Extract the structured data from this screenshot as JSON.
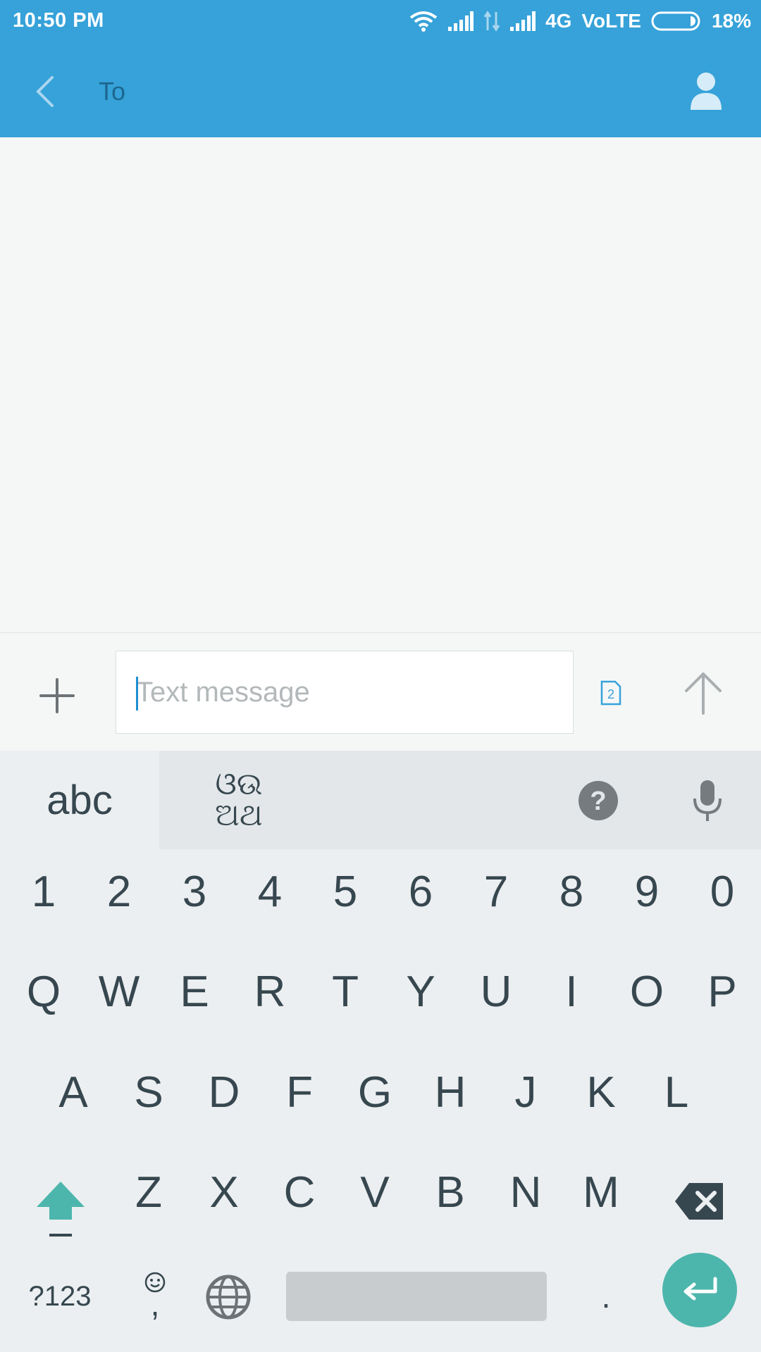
{
  "status_bar": {
    "time": "10:50 PM",
    "network": "4G",
    "volte": "VoLTE",
    "battery": "18%",
    "icons": [
      "wifi-icon",
      "signal-icon",
      "data-transfer-icon",
      "signal-icon",
      "battery-icon"
    ]
  },
  "header": {
    "to_label": "To",
    "back_icon": "chevron-left-icon",
    "contact_icon": "person-icon"
  },
  "composer": {
    "attach_icon": "plus-icon",
    "placeholder": "Text message",
    "value": "",
    "sim_label": "2",
    "send_icon": "arrow-up-icon"
  },
  "keyboard": {
    "tab_abc": "abc",
    "tab_odia_line1": "ଓଉ",
    "tab_odia_line2": "ଅଥ",
    "help_icon": "help-circle-icon",
    "mic_icon": "microphone-icon",
    "number_row": [
      "1",
      "2",
      "3",
      "4",
      "5",
      "6",
      "7",
      "8",
      "9",
      "0"
    ],
    "row1": [
      "Q",
      "W",
      "E",
      "R",
      "T",
      "Y",
      "U",
      "I",
      "O",
      "P"
    ],
    "row2": [
      "A",
      "S",
      "D",
      "F",
      "G",
      "H",
      "J",
      "K",
      "L"
    ],
    "row3": [
      "Z",
      "X",
      "C",
      "V",
      "B",
      "N",
      "M"
    ],
    "symbols_key": "?123",
    "comma_key": ",",
    "period_key": ".",
    "shift_icon": "shift-icon",
    "backspace_icon": "backspace-icon",
    "emoji_icon": "smiley-icon",
    "globe_icon": "globe-icon",
    "enter_icon": "enter-icon",
    "accent_color": "#4db6ac"
  },
  "colors": {
    "header": "#36a2d9",
    "caret": "#1e8fd0"
  }
}
